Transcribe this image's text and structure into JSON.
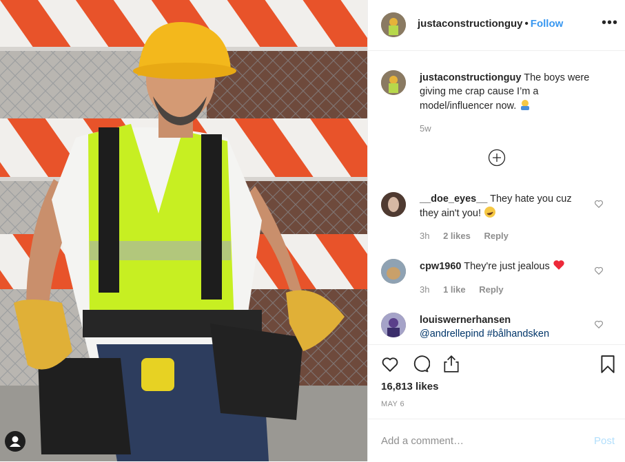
{
  "post": {
    "username": "justaconstructionguy",
    "follow_label": "Follow",
    "more_label": "•••",
    "separator": "•"
  },
  "caption": {
    "username": "justaconstructionguy",
    "text": "The boys were giving me crap cause I’m a model/influencer now.",
    "time": "5w"
  },
  "comments": [
    {
      "username": "__doe_eyes__",
      "text": "They hate you cuz they ain't you!",
      "time": "3h",
      "likes": "2 likes",
      "reply": "Reply"
    },
    {
      "username": "cpw1960",
      "text": "They're just jealous",
      "time": "3h",
      "likes": "1 like",
      "reply": "Reply"
    },
    {
      "username": "louiswernerhansen",
      "mention": "@andrellepind",
      "hashtag": "#bålhandsken"
    }
  ],
  "stats": {
    "likes": "16,813 likes",
    "date": "MAY 6"
  },
  "add_comment": {
    "placeholder": "Add a comment…",
    "post_label": "Post"
  },
  "icons": [
    "heart-icon",
    "comment-icon",
    "share-icon",
    "bookmark-icon",
    "load-more-icon",
    "user-tag-icon",
    "more-icon"
  ],
  "colors": {
    "follow": "#3897f0",
    "muted": "#8e8e8e",
    "post_disabled": "#b2dffc",
    "mention": "#003569",
    "heart_red": "#ed2939"
  }
}
